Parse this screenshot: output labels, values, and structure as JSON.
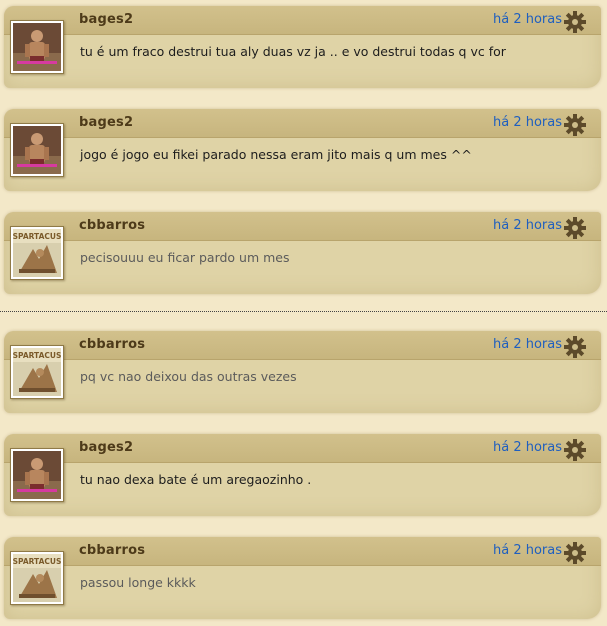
{
  "messages": [
    {
      "author": "bages2",
      "time": "há 2 horas",
      "text": "tu é um fraco destrui tua aly duas vz ja .. e vo destrui todas q vc for",
      "avatar": "gladiator-avatar"
    },
    {
      "author": "bages2",
      "time": "há 2 horas",
      "text": "jogo é jogo eu fikei parado nessa eram jito mais q um mes ^^",
      "avatar": "gladiator-avatar"
    },
    {
      "author": "cbbarros",
      "time": "há 2 horas",
      "text": "pecisouuu eu ficar pardo um mes",
      "avatar": "spartacus-avatar"
    },
    {
      "author": "cbbarros",
      "time": "há 2 horas",
      "text": "pq vc nao deixou das outras vezes",
      "avatar": "spartacus-avatar"
    },
    {
      "author": "bages2",
      "time": "há 2 horas",
      "text": "tu nao dexa bate é um aregaozinho .",
      "avatar": "gladiator-avatar"
    },
    {
      "author": "cbbarros",
      "time": "há 2 horas",
      "text": "passou longe kkkk",
      "avatar": "spartacus-avatar"
    }
  ],
  "avatar_caption": "SPARTACUS",
  "colors": {
    "link": "#1f5fbf",
    "author": "#4d3a19",
    "panel": "#dfd3a6",
    "header": "#c9b780"
  }
}
